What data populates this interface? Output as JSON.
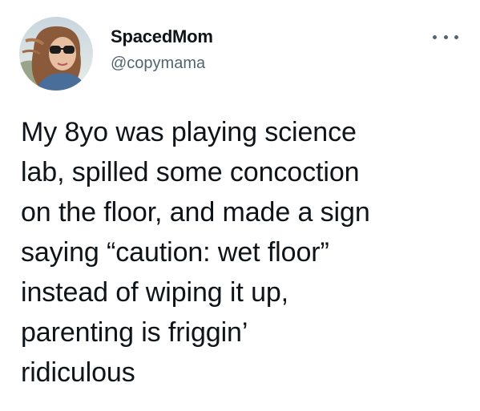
{
  "tweet": {
    "author": {
      "display_name": "SpacedMom",
      "handle": "@copymama",
      "avatar_icon": "avatar-photo"
    },
    "more_icon": "more-options-icon",
    "text_lines": [
      "My 8yo was playing science",
      "lab, spilled some concoction",
      "on the floor, and made a sign",
      "saying “caution: wet floor”",
      "instead of wiping it up,",
      "parenting is friggin’",
      "ridiculous"
    ]
  },
  "colors": {
    "text_primary": "#0f1419",
    "text_secondary": "#536471",
    "background": "#ffffff"
  }
}
